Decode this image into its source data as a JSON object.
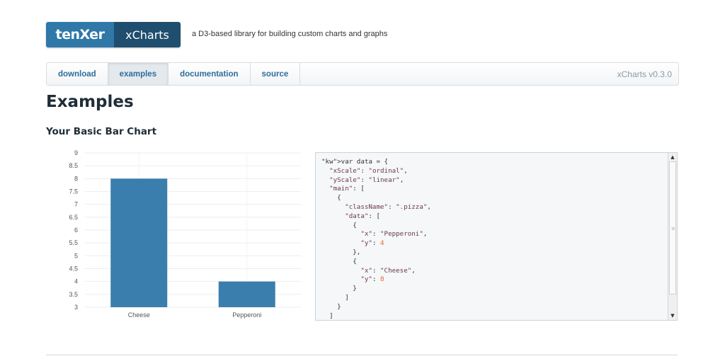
{
  "logo": {
    "brand": "tenXer",
    "product": "xCharts"
  },
  "tagline": "a D3-based library for building custom charts and graphs",
  "nav": {
    "tabs": [
      {
        "label": "download"
      },
      {
        "label": "examples"
      },
      {
        "label": "documentation"
      },
      {
        "label": "source"
      }
    ],
    "active": "examples",
    "version": "xCharts v0.3.0"
  },
  "page_title": "Examples",
  "section_title": "Your Basic Bar Chart",
  "chart_data": {
    "type": "bar",
    "categories": [
      "Cheese",
      "Pepperoni"
    ],
    "values": [
      8,
      4
    ],
    "color": "#3a7ead",
    "ylim": [
      3,
      9
    ],
    "yticks": [
      "3",
      "3.5",
      "4",
      "4.5",
      "5",
      "5.5",
      "6",
      "6.5",
      "7",
      "7.5",
      "8",
      "8.5",
      "9"
    ],
    "grid": true
  },
  "code_lines": [
    "var data = {",
    "  \"xScale\": \"ordinal\",",
    "  \"yScale\": \"linear\",",
    "  \"main\": [",
    "    {",
    "      \"className\": \".pizza\",",
    "      \"data\": [",
    "        {",
    "          \"x\": \"Pepperoni\",",
    "          \"y\": 4",
    "        },",
    "        {",
    "          \"x\": \"Cheese\",",
    "          \"y\": 8",
    "        }",
    "      ]",
    "    }",
    "  ]"
  ]
}
